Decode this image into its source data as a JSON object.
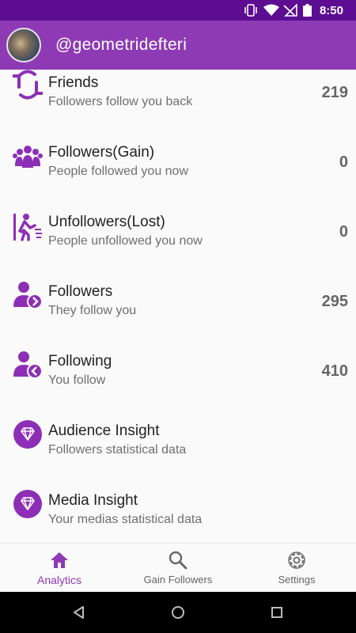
{
  "status_bar": {
    "time": "8:50",
    "icons": [
      "vibrate-icon",
      "wifi-icon",
      "no-signal-icon",
      "battery-icon"
    ]
  },
  "header": {
    "username": "@geometridefteri",
    "avatar": "profile-avatar"
  },
  "rows": [
    {
      "title": "Friends",
      "subtitle": "Followers follow you back",
      "count": "219",
      "icon": "sync-icon"
    },
    {
      "title": "Followers(Gain)",
      "subtitle": "People followed you now",
      "count": "0",
      "icon": "group-icon"
    },
    {
      "title": "Unfollowers(Lost)",
      "subtitle": "People unfollowed you now",
      "count": "0",
      "icon": "running-person-icon"
    },
    {
      "title": "Followers",
      "subtitle": "They follow you",
      "count": "295",
      "icon": "person-arrow-in-icon"
    },
    {
      "title": "Following",
      "subtitle": "You follow",
      "count": "410",
      "icon": "person-arrow-out-icon"
    },
    {
      "title": "Audience Insight",
      "subtitle": "Followers statistical data",
      "icon": "diamond-icon"
    },
    {
      "title": "Media Insight",
      "subtitle": "Your medias statistical data",
      "icon": "diamond-icon"
    }
  ],
  "bottom_nav": [
    {
      "label": "Analytics",
      "icon": "home-icon",
      "active": true
    },
    {
      "label": "Gain Followers",
      "icon": "search-icon",
      "active": false
    },
    {
      "label": "Settings",
      "icon": "gear-icon",
      "active": false
    }
  ],
  "colors": {
    "status_bar": "#5c0d91",
    "app_bar": "#8d3ab4",
    "accent": "#8d3ab4",
    "icon": "#8d2fb6"
  }
}
